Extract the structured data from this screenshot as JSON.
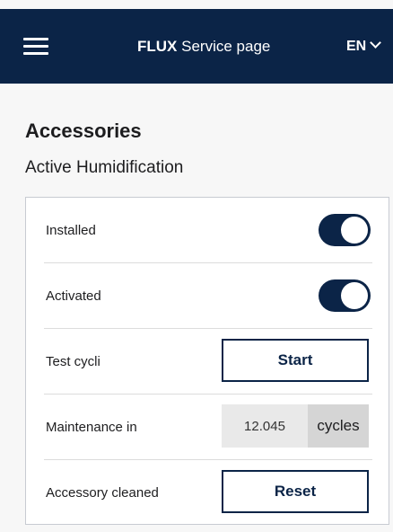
{
  "header": {
    "brand": "FLUX",
    "title_rest": "Service page",
    "language": "EN"
  },
  "page": {
    "title": "Accessories",
    "section_title": "Active Humidification"
  },
  "rows": {
    "installed": {
      "label": "Installed",
      "toggle_on": true
    },
    "activated": {
      "label": "Activated",
      "toggle_on": true
    },
    "test": {
      "label": "Test cycli",
      "button": "Start"
    },
    "maintenance": {
      "label": "Maintenance in",
      "value": "12.045",
      "unit": "cycles"
    },
    "cleaned": {
      "label": "Accessory cleaned",
      "button": "Reset"
    }
  },
  "colors": {
    "header_bg": "#0b2447",
    "accent": "#0b2447",
    "page_bg": "#f7f7f7"
  },
  "icons": {
    "menu": "hamburger-menu-icon",
    "language": "chevron-down-icon"
  }
}
